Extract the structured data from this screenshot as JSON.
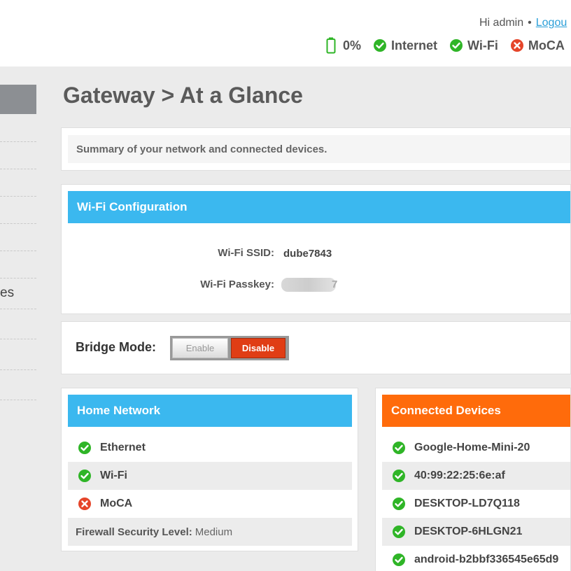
{
  "header": {
    "greeting": "Hi admin",
    "separator": "•",
    "logout_label": "Logou",
    "status": {
      "battery": "0%",
      "internet": {
        "label": "Internet",
        "state": "ok"
      },
      "wifi": {
        "label": "Wi-Fi",
        "state": "ok"
      },
      "moca": {
        "label": "MoCA",
        "state": "error"
      }
    }
  },
  "sidebar": {
    "partial_item_label": "es"
  },
  "page_title": "Gateway > At a Glance",
  "summary_text": "Summary of your network and connected devices.",
  "wifi_config": {
    "title": "Wi-Fi Configuration",
    "ssid_label": "Wi-Fi SSID:",
    "ssid_value": "dube7843",
    "passkey_label": "Wi-Fi Passkey:",
    "passkey_tail": "7"
  },
  "bridge_mode": {
    "label": "Bridge Mode:",
    "enable_label": "Enable",
    "disable_label": "Disable",
    "selected": "Disable"
  },
  "home_network": {
    "title": "Home Network",
    "items": [
      {
        "label": "Ethernet",
        "state": "ok"
      },
      {
        "label": "Wi-Fi",
        "state": "ok"
      },
      {
        "label": "MoCA",
        "state": "error"
      }
    ],
    "firewall_label": "Firewall Security Level:",
    "firewall_value": "Medium"
  },
  "connected_devices": {
    "title": "Connected Devices",
    "items": [
      {
        "label": "Google-Home-Mini-20",
        "state": "ok"
      },
      {
        "label": "40:99:22:25:6e:af",
        "state": "ok"
      },
      {
        "label": "DESKTOP-LD7Q118",
        "state": "ok"
      },
      {
        "label": "DESKTOP-6HLGN21",
        "state": "ok"
      },
      {
        "label": "android-b2bbf336545e65d9",
        "state": "ok"
      }
    ]
  },
  "colors": {
    "ok": "#2fb527",
    "error": "#e5452a",
    "accent_blue": "#3bb8ef",
    "accent_orange": "#ff6b0b",
    "link": "#2a9fd8"
  }
}
